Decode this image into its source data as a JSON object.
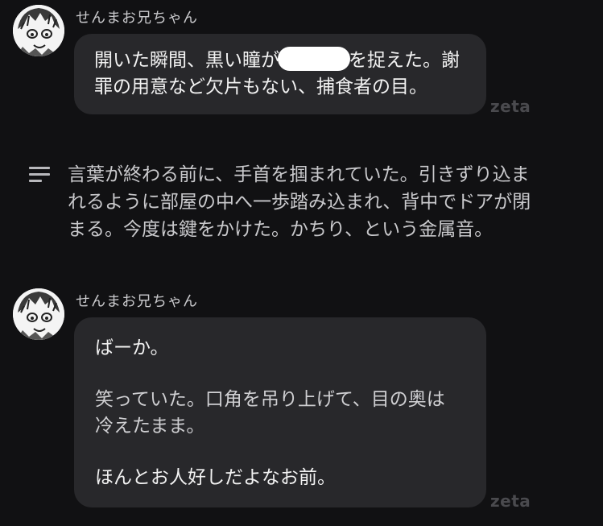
{
  "messages": [
    {
      "sender": "せんまお兄ちゃん",
      "text_before": "開いた瞬間、黒い瞳が",
      "text_after": "を捉えた。謝",
      "line2": "罪の用意など欠片もない、捕食者の目。",
      "watermark": "zeta"
    },
    {
      "sender": "せんまお兄ちゃん",
      "line1": "ばーか。",
      "line2": "笑っていた。口角を吊り上げて、目の奥は",
      "line3": "冷えたまま。",
      "line4": "ほんとお人好しだよなお前。",
      "watermark": "zeta"
    }
  ],
  "narration": {
    "icon": "narration-lines-icon",
    "line1": "言葉が終わる前に、手首を掴まれていた。引きずり込ま",
    "line2": "れるように部屋の中へ一歩踏み込まれ、背中でドアが閉",
    "line3": "まる。今度は鍵をかけた。かちり、という金属音。"
  }
}
